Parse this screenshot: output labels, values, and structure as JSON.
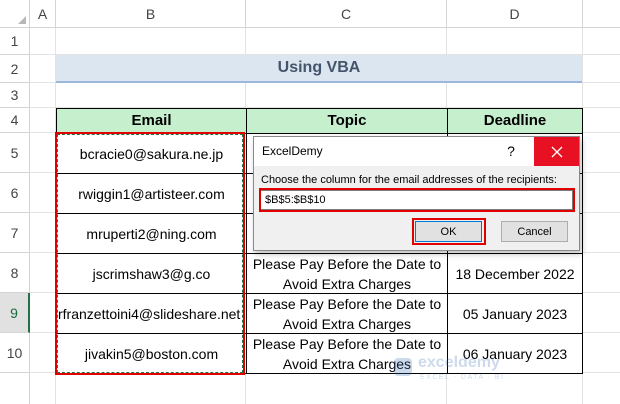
{
  "columns": [
    "A",
    "B",
    "C",
    "D"
  ],
  "rows": [
    "1",
    "2",
    "3",
    "4",
    "5",
    "6",
    "7",
    "8",
    "9",
    "10"
  ],
  "selected_row": "9",
  "title": "Using VBA",
  "table": {
    "headers": [
      "Email",
      "Topic",
      "Deadline"
    ],
    "rows": [
      {
        "email": "bcracie0@sakura.ne.jp",
        "topic": "",
        "deadline": ""
      },
      {
        "email": "rwiggin1@artisteer.com",
        "topic": "",
        "deadline": ""
      },
      {
        "email": "mruperti2@ning.com",
        "topic": "",
        "deadline": ""
      },
      {
        "email": "jscrimshaw3@g.co",
        "topic": "Please Pay Before the Date to Avoid Extra Charges",
        "deadline": "18 December 2022"
      },
      {
        "email": "rfranzettoini4@slideshare.net",
        "topic": "Please Pay Before the Date to Avoid Extra Charges",
        "deadline": "05 January 2023"
      },
      {
        "email": "jivakin5@boston.com",
        "topic": "Please Pay Before the Date to Avoid Extra Charges",
        "deadline": "06 January 2023"
      }
    ]
  },
  "dialog": {
    "title": "ExcelDemy",
    "help": "?",
    "prompt": "Choose the column for the email addresses of the recipients:",
    "input_value": "$B$5:$B$10",
    "ok_label": "OK",
    "cancel_label": "Cancel"
  },
  "watermark": {
    "name": "exceldemy",
    "tagline": "EXCEL · DATA · BI"
  },
  "colors": {
    "header_fill": "#c6efce",
    "title_fill": "#dce6f1",
    "highlight": "#e00000",
    "close": "#e81123"
  }
}
